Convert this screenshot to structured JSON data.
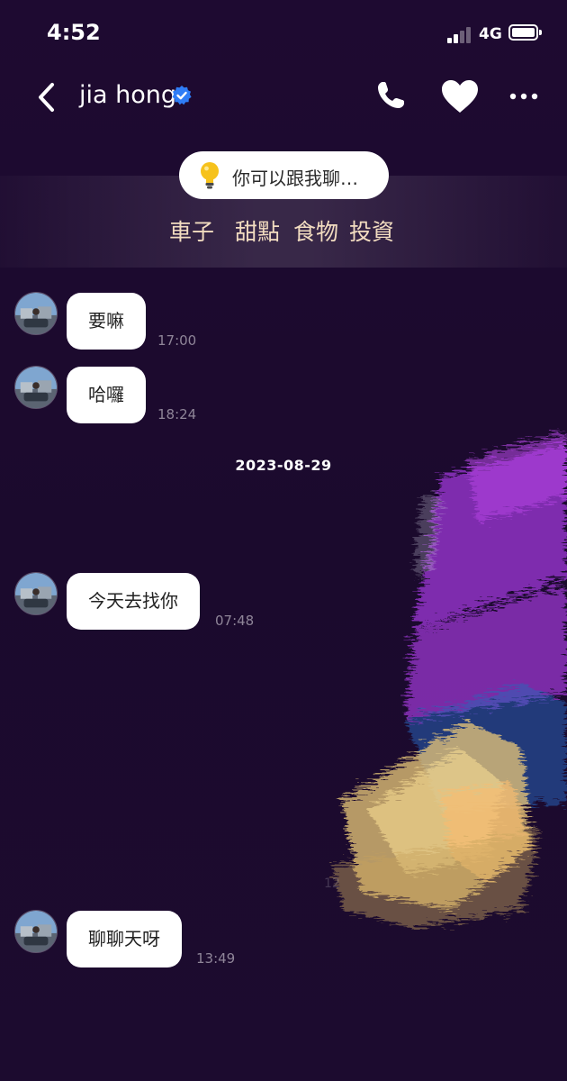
{
  "status_bar": {
    "time": "4:52",
    "network": "4G",
    "signal_bars": 2
  },
  "header": {
    "contact_name": "jia hong",
    "verified": true,
    "icons": [
      "back-icon",
      "verified-icon",
      "phone-icon",
      "heart-icon",
      "more-icon"
    ]
  },
  "suggestions": {
    "hint": "你可以跟我聊…",
    "topics": [
      "車子",
      "甜點",
      "食物",
      "投資"
    ]
  },
  "messages": [
    {
      "text": "要嘛",
      "time": "17:00"
    },
    {
      "text": "哈囉",
      "time": "18:24"
    },
    {
      "text": "今天去找你",
      "time": "07:48"
    },
    {
      "text": "聊聊天呀",
      "time": "13:49"
    }
  ],
  "date_separator": "2023-08-29",
  "background_faint_text": "12",
  "colors": {
    "background": "#1c0b2e",
    "bubble": "#ffffff",
    "topic_text": "#f2dcc0",
    "verified_badge": "#2f7df6",
    "timestamp": "#8f8598",
    "art_purple": "#a33bd6",
    "art_yellow": "#f6d98a",
    "art_blue": "#2d7fe0"
  }
}
